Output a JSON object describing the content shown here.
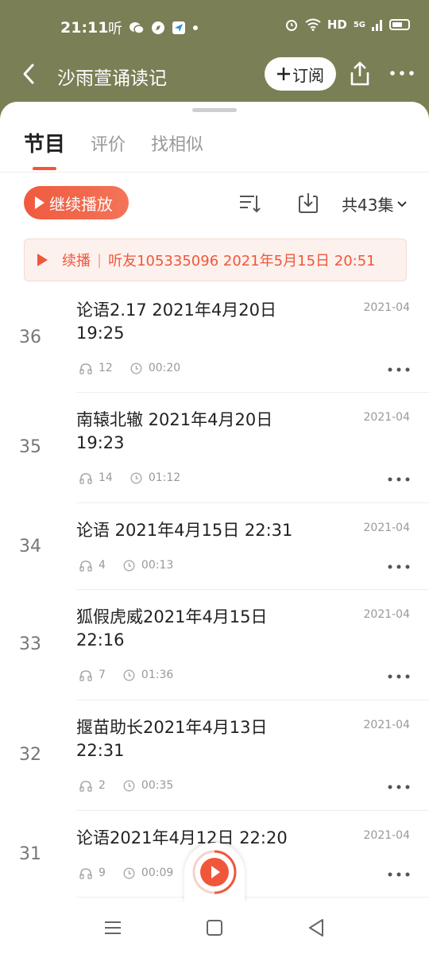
{
  "status_bar": {
    "time": "21:11",
    "app_glyph": "听",
    "hd": "HD",
    "net": "5G"
  },
  "header": {
    "title": "沙雨萱诵读记",
    "subscribe_label": "订阅"
  },
  "tabs": [
    {
      "label": "节目",
      "active": true
    },
    {
      "label": "评价",
      "active": false
    },
    {
      "label": "找相似",
      "active": false
    }
  ],
  "toolbar": {
    "continue_label": "继续播放",
    "episodes_label": "共43集"
  },
  "resume": {
    "label": "续播",
    "detail": "听友105335096 2021年5月15日 20:51"
  },
  "episodes": [
    {
      "num": "36",
      "title": "论语2.17 2021年4月20日 19:25",
      "date": "2021-04",
      "plays": "12",
      "duration": "00:20"
    },
    {
      "num": "35",
      "title": "南辕北辙 2021年4月20日 19:23",
      "date": "2021-04",
      "plays": "14",
      "duration": "01:12"
    },
    {
      "num": "34",
      "title": "论语 2021年4月15日 22:31",
      "date": "2021-04",
      "plays": "4",
      "duration": "00:13"
    },
    {
      "num": "33",
      "title": "狐假虎威2021年4月15日 22:16",
      "date": "2021-04",
      "plays": "7",
      "duration": "01:36"
    },
    {
      "num": "32",
      "title": "揠苗助长2021年4月13日 22:31",
      "date": "2021-04",
      "plays": "2",
      "duration": "00:35"
    },
    {
      "num": "31",
      "title": "论语2021年4月12日 22:20",
      "date": "2021-04",
      "plays": "9",
      "duration": "00:09"
    }
  ],
  "colors": {
    "accent": "#f0573a",
    "header_bg": "#7a7f55"
  }
}
